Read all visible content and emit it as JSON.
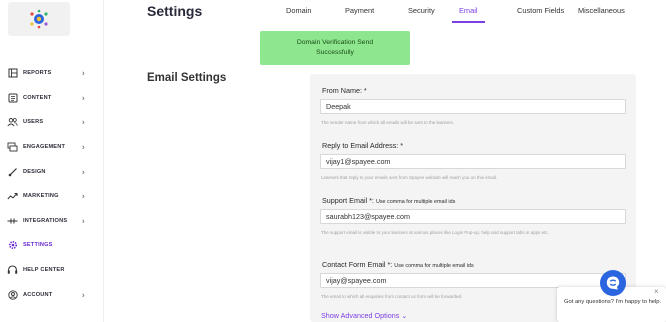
{
  "sidebar": {
    "items": [
      {
        "label": "REPORTS",
        "icon": "reports-icon",
        "chevron": "›"
      },
      {
        "label": "CONTENT",
        "icon": "content-icon",
        "chevron": "›"
      },
      {
        "label": "USERS",
        "icon": "users-icon",
        "chevron": "›"
      },
      {
        "label": "ENGAGEMENT",
        "icon": "engagement-icon",
        "chevron": "›"
      },
      {
        "label": "DESIGN",
        "icon": "design-icon",
        "chevron": "›"
      },
      {
        "label": "MARKETING",
        "icon": "marketing-icon",
        "chevron": "›"
      },
      {
        "label": "INTEGRATIONS",
        "icon": "integrations-icon",
        "chevron": "›"
      },
      {
        "label": "SETTINGS",
        "icon": "settings-icon",
        "chevron": ""
      },
      {
        "label": "HELP CENTER",
        "icon": "help-center-icon",
        "chevron": ""
      },
      {
        "label": "ACCOUNT",
        "icon": "account-icon",
        "chevron": "›"
      }
    ],
    "active": "SETTINGS"
  },
  "header": {
    "title": "Settings",
    "tabs": [
      "Domain",
      "Payment",
      "Security",
      "Email",
      "Custom Fields",
      "Miscellaneous"
    ],
    "active_tab": "Email"
  },
  "toast": {
    "text": "Domain Verification Send Successfully"
  },
  "section_title": "Email Settings",
  "form": {
    "from_name": {
      "label": "From Name: *",
      "value": "Deepak",
      "help": "The sender name from which all emails will be sent to the learners."
    },
    "reply_to": {
      "label": "Reply to Email Address: *",
      "value": "vijay1@spayee.com",
      "help": "Learners that reply to your emails sent from Spayee website will reach you on this email."
    },
    "support_email": {
      "label": "Support Email *:",
      "label_note": "Use comma for multiple email ids",
      "value": "saurabh123@spayee.com",
      "help": "The support email is visible to your learners at various places like Login Pop-up, help and support tabs in apps etc."
    },
    "contact_email": {
      "label": "Contact Form Email *:",
      "label_note": "Use comma for multiple email ids",
      "value": "vijay@spayee.com",
      "help": "The email to which all enquiries from contact us form will be forwarded."
    },
    "advanced_link": "Show Advanced Options"
  },
  "chat": {
    "message": "Got any questions? I'm happy to help.",
    "close": "×"
  },
  "colors": {
    "accent": "#7b3fe4",
    "toast_bg": "#8ee68e",
    "chat_blue": "#2b66e0"
  }
}
